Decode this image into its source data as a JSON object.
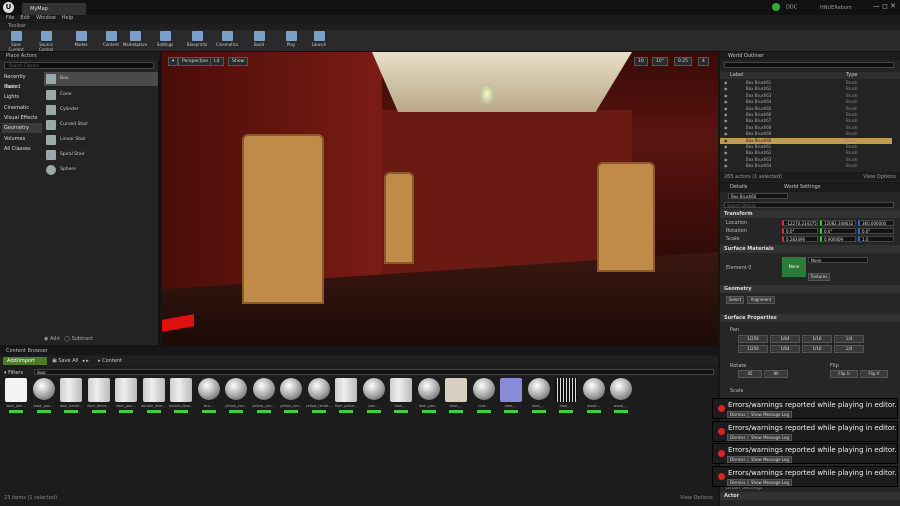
{
  "titlebar": {
    "doc_tab": "MyMap",
    "ddc": "DDC",
    "account": "HNUERebom",
    "window_controls": "— ◻ ✕"
  },
  "menu": [
    "File",
    "Edit",
    "Window",
    "Help"
  ],
  "toolbar": {
    "label": "Toolbar",
    "buttons": [
      "Save Current",
      "Source Control",
      "Modes",
      "Content",
      "Marketplace",
      "Settings",
      "Blueprints",
      "Cinematics",
      "Build",
      "Play",
      "Launch"
    ]
  },
  "place_actors": {
    "title": "Place Actors",
    "search_placeholder": "Search Classes",
    "categories": [
      "Recently Placed",
      "Basic",
      "Lights",
      "Cinematic",
      "Visual Effects",
      "Geometry",
      "Volumes",
      "All Classes"
    ],
    "selected_category": "Geometry",
    "items": [
      "Box",
      "Cone",
      "Cylinder",
      "Curved Stair",
      "Linear Stair",
      "Spiral Stair",
      "Sphere"
    ],
    "add": "Add",
    "subtract": "Subtract"
  },
  "viewport": {
    "perspective": "Perspective",
    "lit": "Lit",
    "show": "Show",
    "grid": "10",
    "angle": "10°",
    "scale": "0.25",
    "cam": "4"
  },
  "outliner": {
    "title": "World Outliner",
    "search_placeholder": "Search...",
    "col_label": "Label",
    "col_type": "Type",
    "rows": [
      {
        "label": "Box Brush61",
        "type": "Brush"
      },
      {
        "label": "Box Brush62",
        "type": "Brush"
      },
      {
        "label": "Box Brush63",
        "type": "Brush"
      },
      {
        "label": "Box Brush64",
        "type": "Brush"
      },
      {
        "label": "Box Brush65",
        "type": "Brush"
      },
      {
        "label": "Box Brush66",
        "type": "Brush"
      },
      {
        "label": "Box Brush67",
        "type": "Brush"
      },
      {
        "label": "Box Brush68",
        "type": "Brush"
      },
      {
        "label": "Box Brush69",
        "type": "Brush"
      },
      {
        "label": "Box Brush60",
        "type": "Brush"
      },
      {
        "label": "Box Brush61",
        "type": "Brush"
      },
      {
        "label": "Box Brush62",
        "type": "Brush"
      },
      {
        "label": "Box Brush63",
        "type": "Brush"
      },
      {
        "label": "Box Brush64",
        "type": "Brush"
      }
    ],
    "selected_index": 9,
    "footer": "265 actors (1 selected)",
    "view_options": "View Options"
  },
  "details": {
    "tab_details": "Details",
    "tab_world": "World Settings",
    "name": "Box Brush60",
    "search_placeholder": "Search Details",
    "transform": "Transform",
    "location_label": "Location",
    "rotation_label": "Rotation",
    "scale_label": "Scale",
    "location": [
      "-12270.234375",
      "12082.348632",
      "360.000000"
    ],
    "rotation": [
      "0.0°",
      "0.0°",
      "0.0°"
    ],
    "scale": [
      "0.283496",
      "0.900009",
      "1.0"
    ],
    "surface_materials": "Surface Materials",
    "element_label": "Element 0",
    "material": "None",
    "mat_swatch": "None",
    "textures": "Textures",
    "geometry": "Geometry",
    "select": "Select",
    "alignment": "Alignment",
    "surface_properties": "Surface Properties",
    "pan": "Pan",
    "pan_vals": [
      "1/256",
      "1/64",
      "1/16",
      "1/4"
    ],
    "rotate": "Rotate",
    "rotate_vals": [
      "45",
      "90"
    ],
    "flip": "Flip",
    "flip_u": "Flip U",
    "flip_v": "Flip V",
    "scale_sp": "Scale",
    "brush_settings": "Brush Settings",
    "actor": "Actor"
  },
  "content_browser": {
    "title": "Content Browser",
    "add_import": "Add/Import",
    "save_all": "Save All",
    "path": "Content",
    "filters": "Filters",
    "search_value": "door",
    "items": [
      "door_pan...",
      "base_pan...",
      "door_bevel...",
      "door_bevel...",
      "door_pan...",
      "double_door...",
      "double_door...",
      "bro...",
      "yellow_con...",
      "yellow_con...",
      "yellow_con...",
      "yellow_rectal...",
      "floor_plane...",
      "pan...",
      "door_...",
      "door_pan...",
      "door_...",
      "mat...",
      "door_...",
      "door_...",
      "door_...",
      "wood...",
      "wood_..."
    ],
    "footer": "23 items (1 selected)",
    "view_options": "View Options"
  },
  "toasts": [
    {
      "msg": "Errors/warnings reported while playing in editor.",
      "dismiss": "Dismiss",
      "show": "Show Message Log"
    },
    {
      "msg": "Errors/warnings reported while playing in editor.",
      "dismiss": "Dismiss",
      "show": "Show Message Log"
    },
    {
      "msg": "Errors/warnings reported while playing in editor.",
      "dismiss": "Dismiss",
      "show": "Show Message Log"
    },
    {
      "msg": "Errors/warnings reported while playing in editor.",
      "dismiss": "Dismiss",
      "show": "Show Message Log"
    }
  ]
}
